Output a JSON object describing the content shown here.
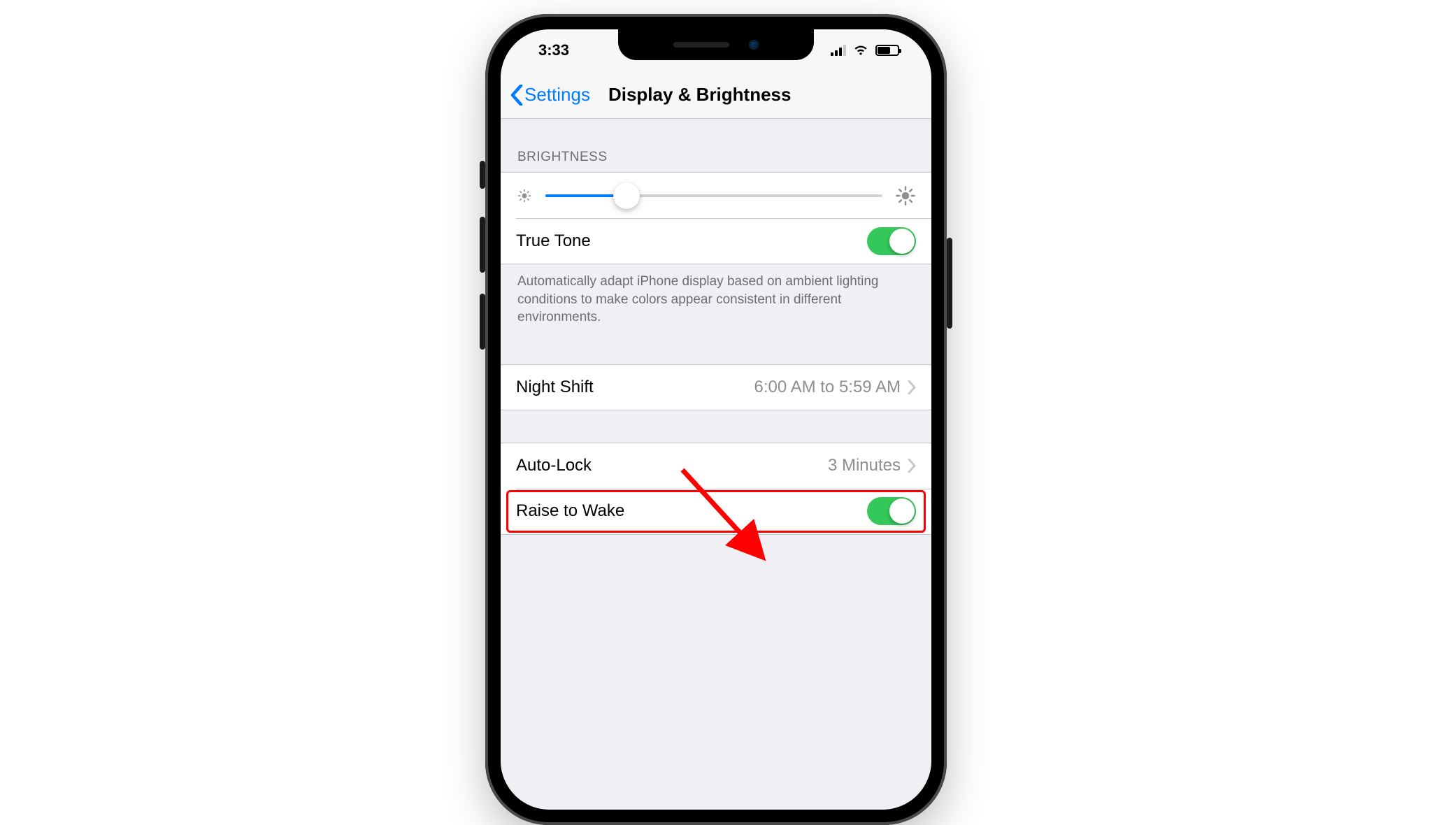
{
  "status": {
    "time": "3:33"
  },
  "nav": {
    "back_label": "Settings",
    "title": "Display & Brightness"
  },
  "brightness": {
    "section_header": "BRIGHTNESS",
    "value_percent": 24,
    "true_tone_label": "True Tone",
    "true_tone_on": true,
    "footer": "Automatically adapt iPhone display based on ambient lighting conditions to make colors appear consistent in different environments."
  },
  "night_shift": {
    "label": "Night Shift",
    "value": "6:00 AM to 5:59 AM"
  },
  "auto_lock": {
    "label": "Auto-Lock",
    "value": "3 Minutes"
  },
  "raise_to_wake": {
    "label": "Raise to Wake",
    "on": true
  }
}
